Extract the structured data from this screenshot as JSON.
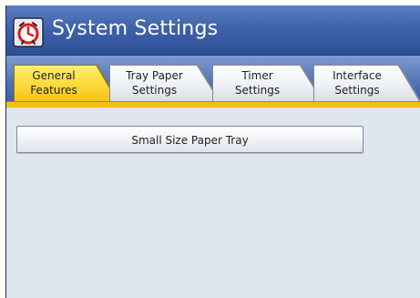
{
  "window": {
    "title": "System Settings",
    "icon": "alarm-clock-icon"
  },
  "tabs": [
    {
      "line1": "General",
      "line2": "Features",
      "active": true
    },
    {
      "line1": "Tray Paper",
      "line2": "Settings",
      "active": false
    },
    {
      "line1": "Timer",
      "line2": "Settings",
      "active": false
    },
    {
      "line1": "Interface",
      "line2": "Settings",
      "active": false
    }
  ],
  "main": {
    "buttons": [
      {
        "label": "Small Size Paper Tray"
      }
    ]
  },
  "colors": {
    "title_bar": "#3f63ab",
    "active_tab": "#ffd93a",
    "content_bg": "#dfe6ee"
  }
}
